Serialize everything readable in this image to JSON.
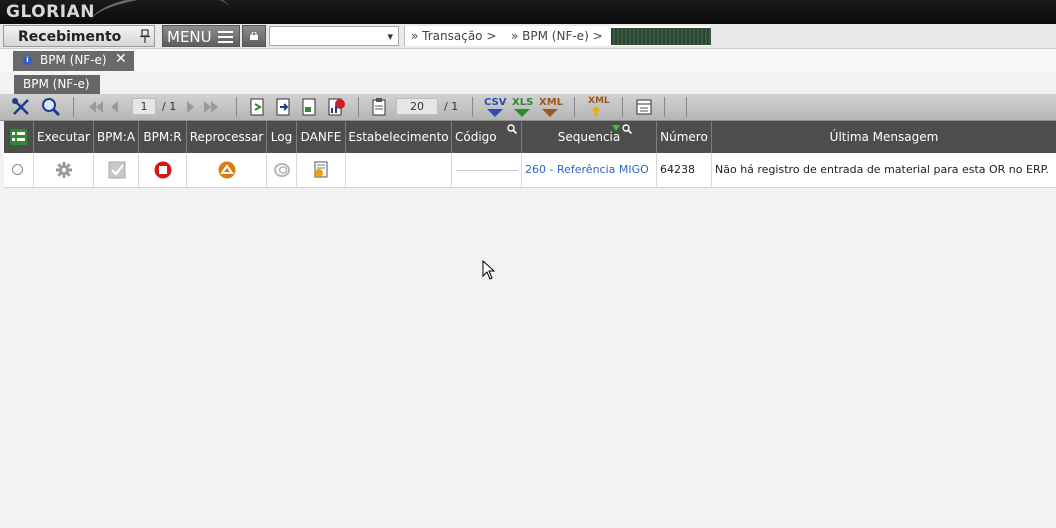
{
  "brand": {
    "name": "GLORIAN"
  },
  "nav": {
    "module_title": "Recebimento",
    "menu_label": "MENU",
    "select_value": "",
    "breadcrumbs": [
      "» Transação >",
      "» BPM (NF-e) >"
    ]
  },
  "tabs": [
    {
      "label": "BPM (NF-e)",
      "close": "✕"
    }
  ],
  "page": {
    "subtitle": "BPM (NF-e)"
  },
  "toolbar": {
    "page_current": "1",
    "page_total": "/ 1",
    "page_size": "20",
    "page_size_total": "/ 1",
    "export_csv": "CSV",
    "export_xls": "XLS",
    "export_xml": "XML",
    "export_xml2": "XML"
  },
  "table": {
    "headers": [
      "Executar",
      "BPM:A",
      "BPM:R",
      "Reprocessar",
      "Log",
      "DANFE",
      "Estabelecimento",
      "Código",
      "Sequencia",
      "Número",
      "Última Mensagem"
    ],
    "rows": [
      {
        "estabelecimento": "",
        "codigo": "",
        "sequencia": "260 - Referência MIGO",
        "numero": "64238",
        "mensagem": "Não há registro de entrada de material para esta OR no ERP."
      }
    ]
  },
  "colors": {
    "header_bg": "#4d4d4d",
    "link": "#2c66c8",
    "csv": "#2a4fb0",
    "xls": "#2f8a2f",
    "xml": "#9a5a1e"
  }
}
